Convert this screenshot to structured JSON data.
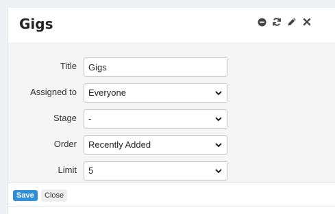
{
  "panel": {
    "title": "Gigs",
    "icons": [
      "minus-circle-icon",
      "refresh-icon",
      "pencil-icon",
      "close-icon"
    ]
  },
  "form": {
    "title": {
      "label": "Title",
      "value": "Gigs"
    },
    "assigned_to": {
      "label": "Assigned to",
      "value": "Everyone"
    },
    "stage": {
      "label": "Stage",
      "value": "-"
    },
    "order": {
      "label": "Order",
      "value": "Recently Added"
    },
    "limit": {
      "label": "Limit",
      "value": "5"
    }
  },
  "footer": {
    "save_label": "Save",
    "close_label": "Close"
  },
  "colors": {
    "primary_button": "#2f8fd8",
    "form_bg": "#f5f5f5"
  }
}
